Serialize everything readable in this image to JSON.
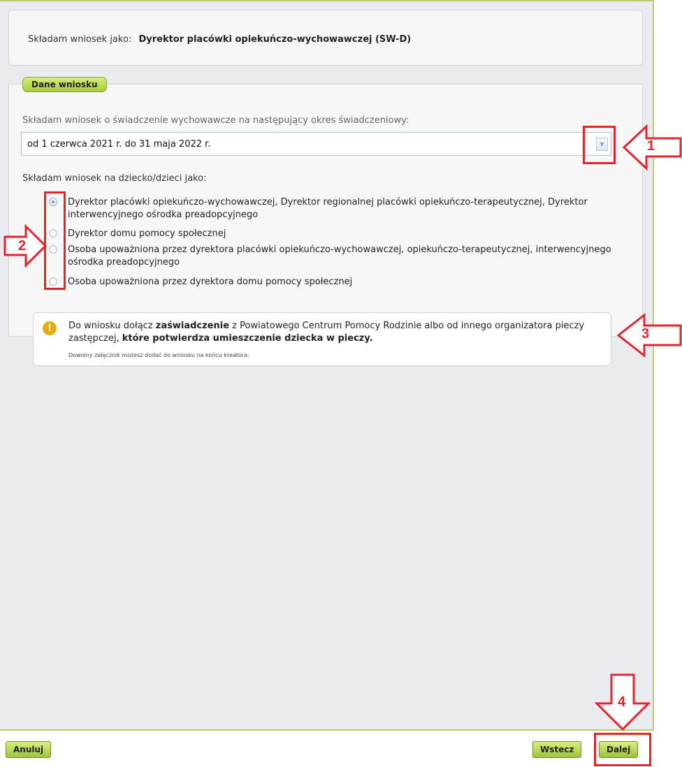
{
  "header": {
    "role_label": "Składam wniosek jako:",
    "role_value": "Dyrektor placówki opiekuńczo-wychowawczej (SW-D)"
  },
  "section": {
    "title": "Dane wniosku",
    "period_question": "Składam wniosek o świadczenie wychowawcze na następujący okres świadczeniowy:",
    "period_value": "od 1 czerwca 2021 r. do 31 maja 2022 r.",
    "children_question": "Składam wniosek na dziecko/dzieci jako:",
    "options": [
      {
        "label": "Dyrektor placówki opiekuńczo-wychowawczej, Dyrektor regionalnej placówki opiekuńczo-terapeutycznej, Dyrektor interwencyjnego ośrodka preadopcyjnego",
        "checked": true
      },
      {
        "label": "Dyrektor domu pomocy społecznej",
        "checked": false
      },
      {
        "label": "Osoba upoważniona przez dyrektora placówki opiekuńczo-wychowawczej, opiekuńczo-terapeutycznej, interwencyjnego ośrodka preadopcyjnego",
        "checked": false
      },
      {
        "label": "Osoba upoważniona przez dyrektora domu pomocy społecznej",
        "checked": false
      }
    ]
  },
  "info": {
    "icon": "exclamation-icon",
    "text_part1": "Do wniosku dołącz ",
    "text_bold1": "zaświadczenie",
    "text_part2": " z Powiatowego Centrum Pomocy Rodzinie albo od innego organizatora pieczy zastępczej, ",
    "text_bold2": "które potwierdza umieszczenie dziecka w pieczy.",
    "small_note": "Dowolny załącznik możesz dodać do wniosku na końcu kreatora."
  },
  "annotations": [
    "1",
    "2",
    "3",
    "4"
  ],
  "buttons": {
    "cancel": "Anuluj",
    "back": "Wstecz",
    "next": "Dalej"
  },
  "colors": {
    "annotation": "#e3242b",
    "button_green": "#a8cc3e",
    "border_green": "#b8cc6e"
  }
}
